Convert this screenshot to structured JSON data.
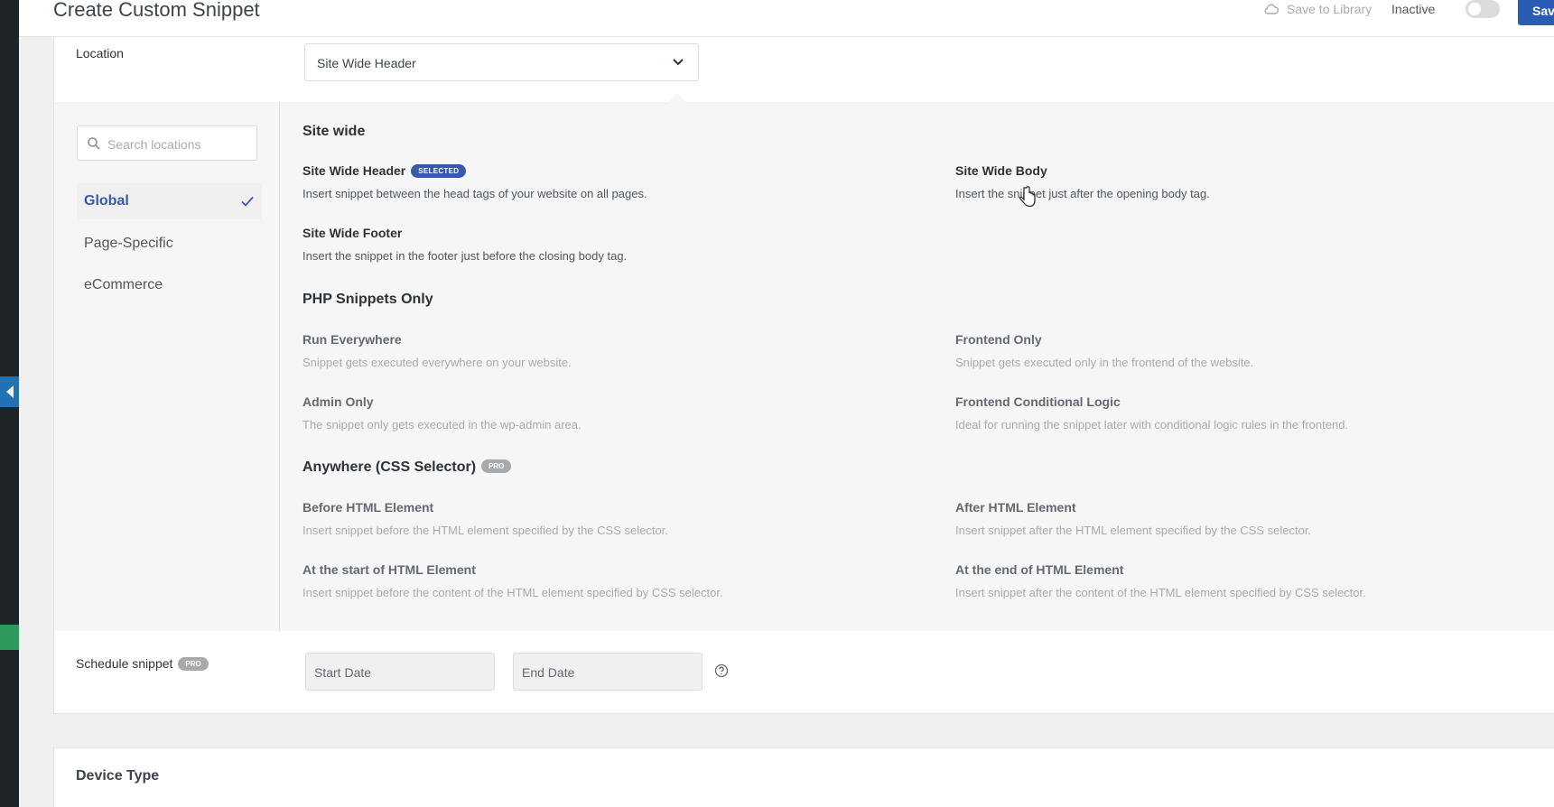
{
  "header": {
    "title": "Create Custom Snippet",
    "save_to_library": "Save to Library",
    "status_label": "Inactive",
    "save_button": "Save S"
  },
  "location": {
    "label": "Location",
    "selected": "Site Wide Header"
  },
  "picker": {
    "search_placeholder": "Search locations",
    "categories": [
      {
        "label": "Global",
        "active": true
      },
      {
        "label": "Page-Specific",
        "active": false
      },
      {
        "label": "eCommerce",
        "active": false
      }
    ],
    "sections": [
      {
        "title": "Site wide",
        "options": [
          {
            "title": "Site Wide Header",
            "badge": "SELECTED",
            "desc": "Insert snippet between the head tags of your website on all pages."
          },
          {
            "title": "Site Wide Body",
            "desc": "Insert the snippet just after the opening body tag."
          },
          {
            "title": "Site Wide Footer",
            "desc": "Insert the snippet in the footer just before the closing body tag."
          }
        ]
      },
      {
        "title": "PHP Snippets Only",
        "options": [
          {
            "title": "Run Everywhere",
            "desc": "Snippet gets executed everywhere on your website."
          },
          {
            "title": "Frontend Only",
            "desc": "Snippet gets executed only in the frontend of the website."
          },
          {
            "title": "Admin Only",
            "desc": "The snippet only gets executed in the wp-admin area."
          },
          {
            "title": "Frontend Conditional Logic",
            "desc": "Ideal for running the snippet later with conditional logic rules in the frontend."
          }
        ]
      },
      {
        "title": "Anywhere (CSS Selector)",
        "badge": "PRO",
        "options": [
          {
            "title": "Before HTML Element",
            "desc": "Insert snippet before the HTML element specified by the CSS selector."
          },
          {
            "title": "After HTML Element",
            "desc": "Insert snippet after the HTML element specified by the CSS selector."
          },
          {
            "title": "At the start of HTML Element",
            "desc": "Insert snippet before the content of the HTML element specified by CSS selector."
          },
          {
            "title": "At the end of HTML Element",
            "desc": "Insert snippet after the content of the HTML element specified by CSS selector."
          }
        ]
      }
    ]
  },
  "schedule": {
    "label": "Schedule snippet",
    "badge": "PRO",
    "start_placeholder": "Start Date",
    "end_placeholder": "End Date"
  },
  "device": {
    "title": "Device Type"
  },
  "colors": {
    "accent": "#3858a8",
    "save_button": "#2a5cb4",
    "admin_bar": "#1d2327"
  },
  "icons": [
    "cloud-icon",
    "chevron-down-icon",
    "search-icon",
    "check-icon",
    "help-icon",
    "cursor-icon"
  ]
}
